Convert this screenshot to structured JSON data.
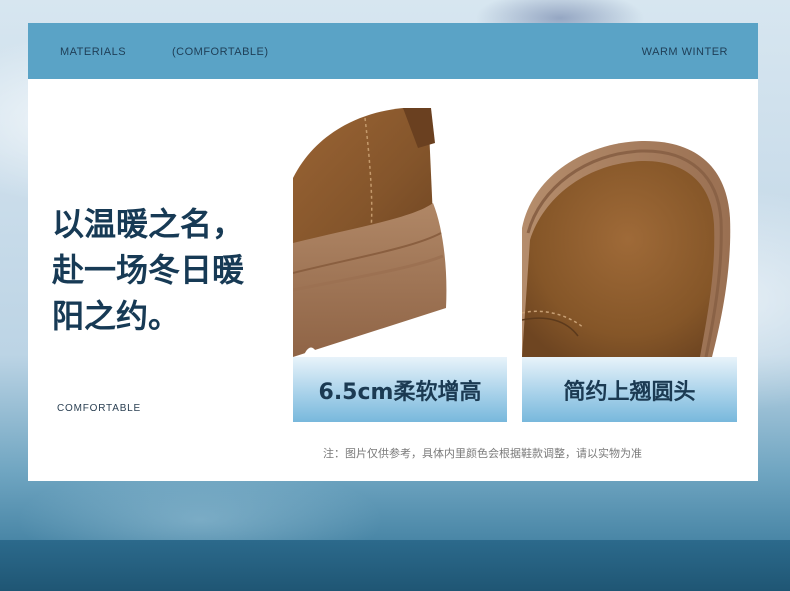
{
  "header": {
    "left": "MATERIALS",
    "middle": "(COMFORTABLE)",
    "right": "WARM WINTER"
  },
  "headline": {
    "line1": "以温暖之名，",
    "line2": "赴一场冬日暖",
    "line3": "阳之约。"
  },
  "comfort_label": "COMFORTABLE",
  "features": [
    {
      "caption": "6.5cm柔软增高",
      "image": "shoe-sole-closeup"
    },
    {
      "caption": "简约上翘圆头",
      "image": "shoe-toe-closeup"
    }
  ],
  "note": "注：图片仅供参考，具体内里颜色会根据鞋款调整，请以实物为准",
  "colors": {
    "header_bg": "#5aa3c6",
    "headline_text": "#173a55",
    "suede": "#8b5a2e",
    "sole": "#a57b5a"
  }
}
